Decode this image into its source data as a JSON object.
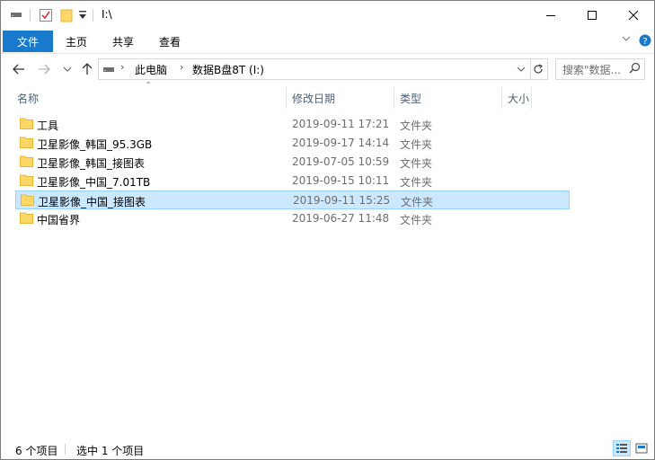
{
  "window": {
    "title": "I:\\"
  },
  "quick_access": {
    "icons": [
      "drive-icon",
      "properties-checkbox-icon",
      "new-folder-icon",
      "customize-dropdown-icon"
    ]
  },
  "ribbon": {
    "file_label": "文件",
    "tabs": [
      "主页",
      "共享",
      "查看"
    ]
  },
  "address": {
    "crumbs": [
      "此电脑",
      "数据B盘8T (I:)"
    ]
  },
  "search": {
    "placeholder": "搜索\"数据..."
  },
  "columns": {
    "name": "名称",
    "date": "修改日期",
    "type": "类型",
    "size": "大小"
  },
  "items": [
    {
      "name": "工具",
      "date": "2019-09-11 17:21",
      "type": "文件夹",
      "selected": false
    },
    {
      "name": "卫星影像_韩国_95.3GB",
      "date": "2019-09-17 14:14",
      "type": "文件夹",
      "selected": false
    },
    {
      "name": "卫星影像_韩国_接图表",
      "date": "2019-07-05 10:59",
      "type": "文件夹",
      "selected": false
    },
    {
      "name": "卫星影像_中国_7.01TB",
      "date": "2019-09-15 10:11",
      "type": "文件夹",
      "selected": false
    },
    {
      "name": "卫星影像_中国_接图表",
      "date": "2019-09-11 15:25",
      "type": "文件夹",
      "selected": true
    },
    {
      "name": "中国省界",
      "date": "2019-06-27 11:48",
      "type": "文件夹",
      "selected": false
    }
  ],
  "status": {
    "count": "6 个项目",
    "selection": "选中 1 个项目"
  },
  "colors": {
    "accent": "#1979ca",
    "selection_bg": "#cce8ff",
    "selection_border": "#99d1ff",
    "folder": "#ffd766"
  }
}
